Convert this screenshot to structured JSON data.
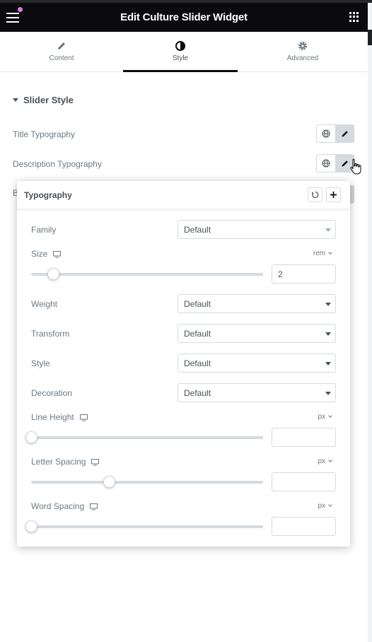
{
  "header": {
    "title": "Edit Culture Slider Widget",
    "menu_icon": "hamburger-icon",
    "apps_icon": "grid-icon"
  },
  "tabs": [
    {
      "label": "Content",
      "icon": "pencil-icon",
      "active": false
    },
    {
      "label": "Style",
      "icon": "contrast-icon",
      "active": true
    },
    {
      "label": "Advanced",
      "icon": "gear-icon",
      "active": false
    }
  ],
  "section": {
    "title": "Slider Style"
  },
  "controls": {
    "title_typography": "Title Typography",
    "description_typography": "Description Typography",
    "hidden_row_initial": "B"
  },
  "typography_popover": {
    "title": "Typography",
    "family": {
      "label": "Family",
      "value": "Default"
    },
    "size": {
      "label": "Size",
      "unit": "rem",
      "value": "2",
      "slider_fraction": 0.095
    },
    "weight": {
      "label": "Weight",
      "value": "Default"
    },
    "transform": {
      "label": "Transform",
      "value": "Default"
    },
    "style": {
      "label": "Style",
      "value": "Default"
    },
    "decoration": {
      "label": "Decoration",
      "value": "Default"
    },
    "line_height": {
      "label": "Line Height",
      "unit": "px",
      "value": "",
      "slider_fraction": 0.0
    },
    "letter_spacing": {
      "label": "Letter Spacing",
      "unit": "px",
      "value": "",
      "slider_fraction": 0.335
    },
    "word_spacing": {
      "label": "Word Spacing",
      "unit": "px",
      "value": "",
      "slider_fraction": 0.0
    }
  },
  "colors": {
    "header_bg": "#0b0b0d",
    "active_tab": "#0b0b0d",
    "accent_dot": "#e07ae8"
  }
}
